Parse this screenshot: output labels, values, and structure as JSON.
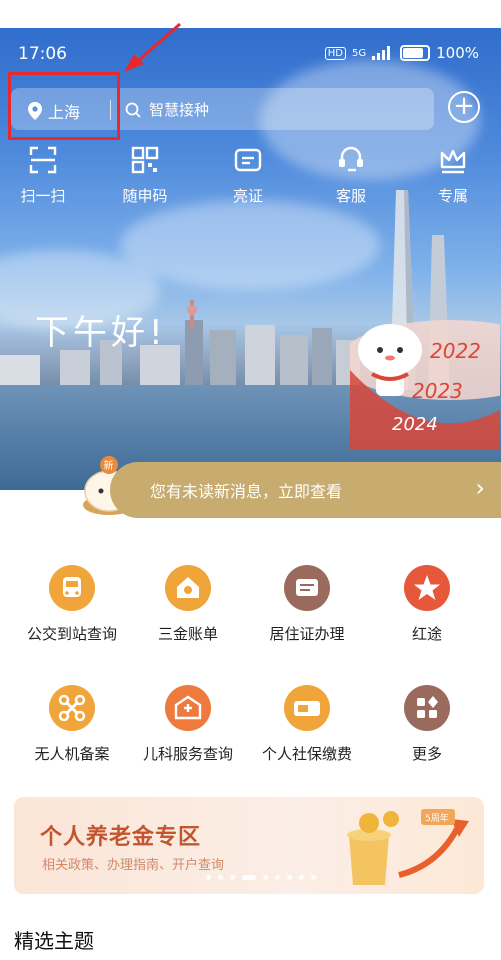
{
  "status_bar": {
    "time": "17:06",
    "network": "5G",
    "battery": "100%"
  },
  "location": {
    "city": "上海"
  },
  "search": {
    "placeholder": "智慧接种"
  },
  "quick_actions": [
    {
      "label": "扫一扫",
      "icon": "scan-icon"
    },
    {
      "label": "随申码",
      "icon": "qr-code-icon"
    },
    {
      "label": "亮证",
      "icon": "id-card-icon"
    },
    {
      "label": "客服",
      "icon": "customer-service-icon"
    },
    {
      "label": "专属",
      "icon": "crown-icon"
    }
  ],
  "greeting": "下午好!",
  "banner_years": [
    "2022",
    "2023",
    "2024"
  ],
  "notice": {
    "badge": "新",
    "text": "您有未读新消息，立即查看"
  },
  "services": [
    {
      "label": "公交到站查询",
      "icon": "bus-icon",
      "color": "#f0a53a"
    },
    {
      "label": "三金账单",
      "icon": "house-coin-icon",
      "color": "#f0a53a"
    },
    {
      "label": "居住证办理",
      "icon": "card-icon",
      "color": "#9a6b5c"
    },
    {
      "label": "红途",
      "icon": "red-star-icon",
      "color": "#e6583a"
    },
    {
      "label": "无人机备案",
      "icon": "drone-icon",
      "color": "#f0a53a"
    },
    {
      "label": "儿科服务查询",
      "icon": "hospital-icon",
      "color": "#ee7a3d"
    },
    {
      "label": "个人社保缴费",
      "icon": "social-security-icon",
      "color": "#f0a53a"
    },
    {
      "label": "更多",
      "icon": "grid-more-icon",
      "color": "#9a6b5c"
    }
  ],
  "promo": {
    "title": "个人养老金专区",
    "subtitle": "相关政策、办理指南、开户查询",
    "tag": "5周年"
  },
  "section": {
    "title": "精选主题"
  }
}
